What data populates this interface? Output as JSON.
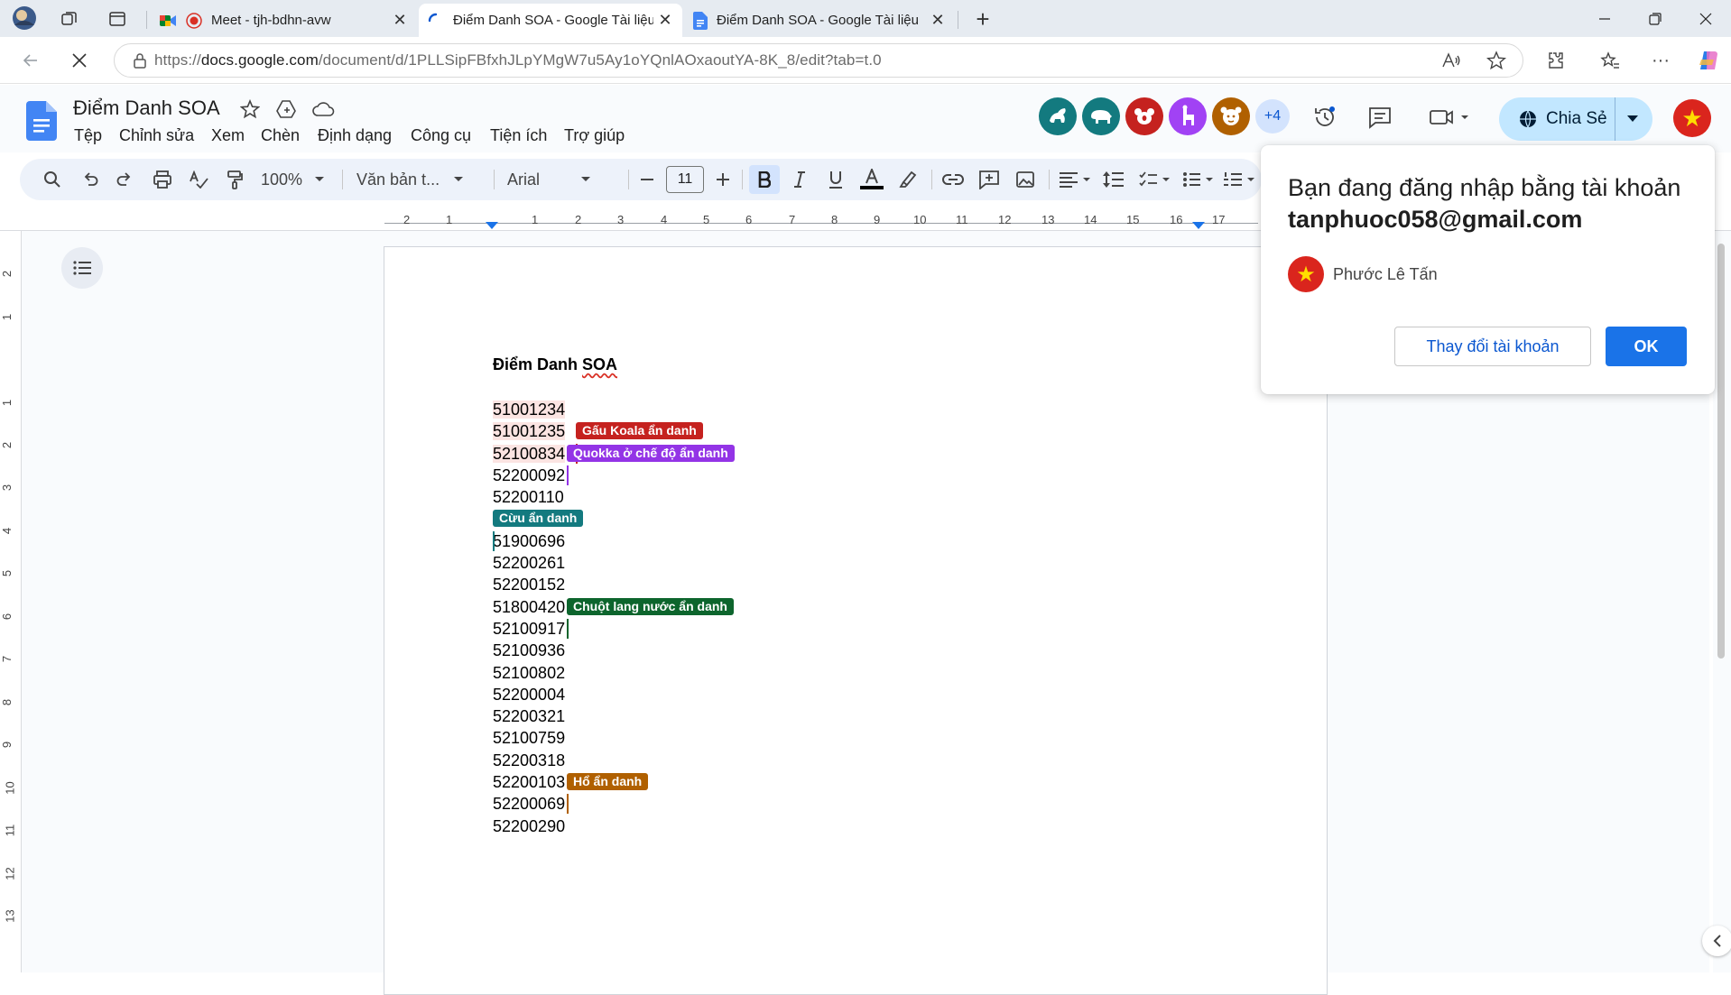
{
  "browser": {
    "tabs": [
      {
        "title": "Meet - tjh-bdhn-avw",
        "active": false
      },
      {
        "title": "Điểm Danh SOA - Google Tài liệu",
        "active": true
      },
      {
        "title": "Điểm Danh SOA - Google Tài liệu",
        "active": false
      }
    ],
    "url_prefix": "https://",
    "url_host": "docs.google.com",
    "url_path": "/document/d/1PLLSipFBfxhJLpYMgW7u5Ay1oYQnlAOxaoutYA-8K_8/edit?tab=t.0"
  },
  "docs": {
    "title": "Điểm Danh SOA",
    "menu": [
      "Tệp",
      "Chỉnh sửa",
      "Xem",
      "Chèn",
      "Định dạng",
      "Công cụ",
      "Tiện ích",
      "Trợ giúp"
    ],
    "collaborators_more": "+4",
    "share_label": "Chia Sẻ",
    "colors": {
      "accent": "#0b57d0",
      "share_bg": "#c2e7ff",
      "ok_button": "#1a73e8"
    }
  },
  "toolbar": {
    "zoom": "100%",
    "style": "Văn bản t...",
    "font": "Arial",
    "font_size": "11"
  },
  "ruler": {
    "h_ticks": [
      "2",
      "1",
      "1",
      "2",
      "3",
      "4",
      "5",
      "6",
      "7",
      "8",
      "9",
      "10",
      "11",
      "12",
      "13",
      "14",
      "15",
      "16",
      "17"
    ],
    "v_ticks": [
      "2",
      "1",
      "1",
      "2",
      "3",
      "4",
      "5",
      "6",
      "7",
      "8",
      "9",
      "10",
      "11",
      "12",
      "13"
    ]
  },
  "document": {
    "heading_prefix": "Điểm Danh ",
    "heading_misspelled": "SOA",
    "numbers": [
      "51001234",
      "51001235",
      "52100834",
      "52200092",
      "52200110",
      "",
      "51900696",
      "52200261",
      "52200152",
      "51800420",
      "52100917",
      "52100936",
      "52100802",
      "52200004",
      "52200321",
      "52100759",
      "52200318",
      "52200103",
      "52200069",
      "52200290"
    ],
    "cursors": [
      {
        "label": "Gấu Koala ẩn danh",
        "color": "#c5221f"
      },
      {
        "label": "Quokka ở chế độ ẩn danh",
        "color": "#9334e6"
      },
      {
        "label": "Cừu ẩn danh",
        "color": "#137a7f"
      },
      {
        "label": "Chuột lang nước ẩn danh",
        "color": "#0d652d"
      },
      {
        "label": "Hổ ẩn danh",
        "color": "#b06000"
      }
    ]
  },
  "popup": {
    "title": "Bạn đang đăng nhập bằng tài khoản",
    "email": "tanphuoc058@gmail.com",
    "user_name": "Phước Lê Tấn",
    "change_label": "Thay đổi tài khoản",
    "ok_label": "OK"
  }
}
